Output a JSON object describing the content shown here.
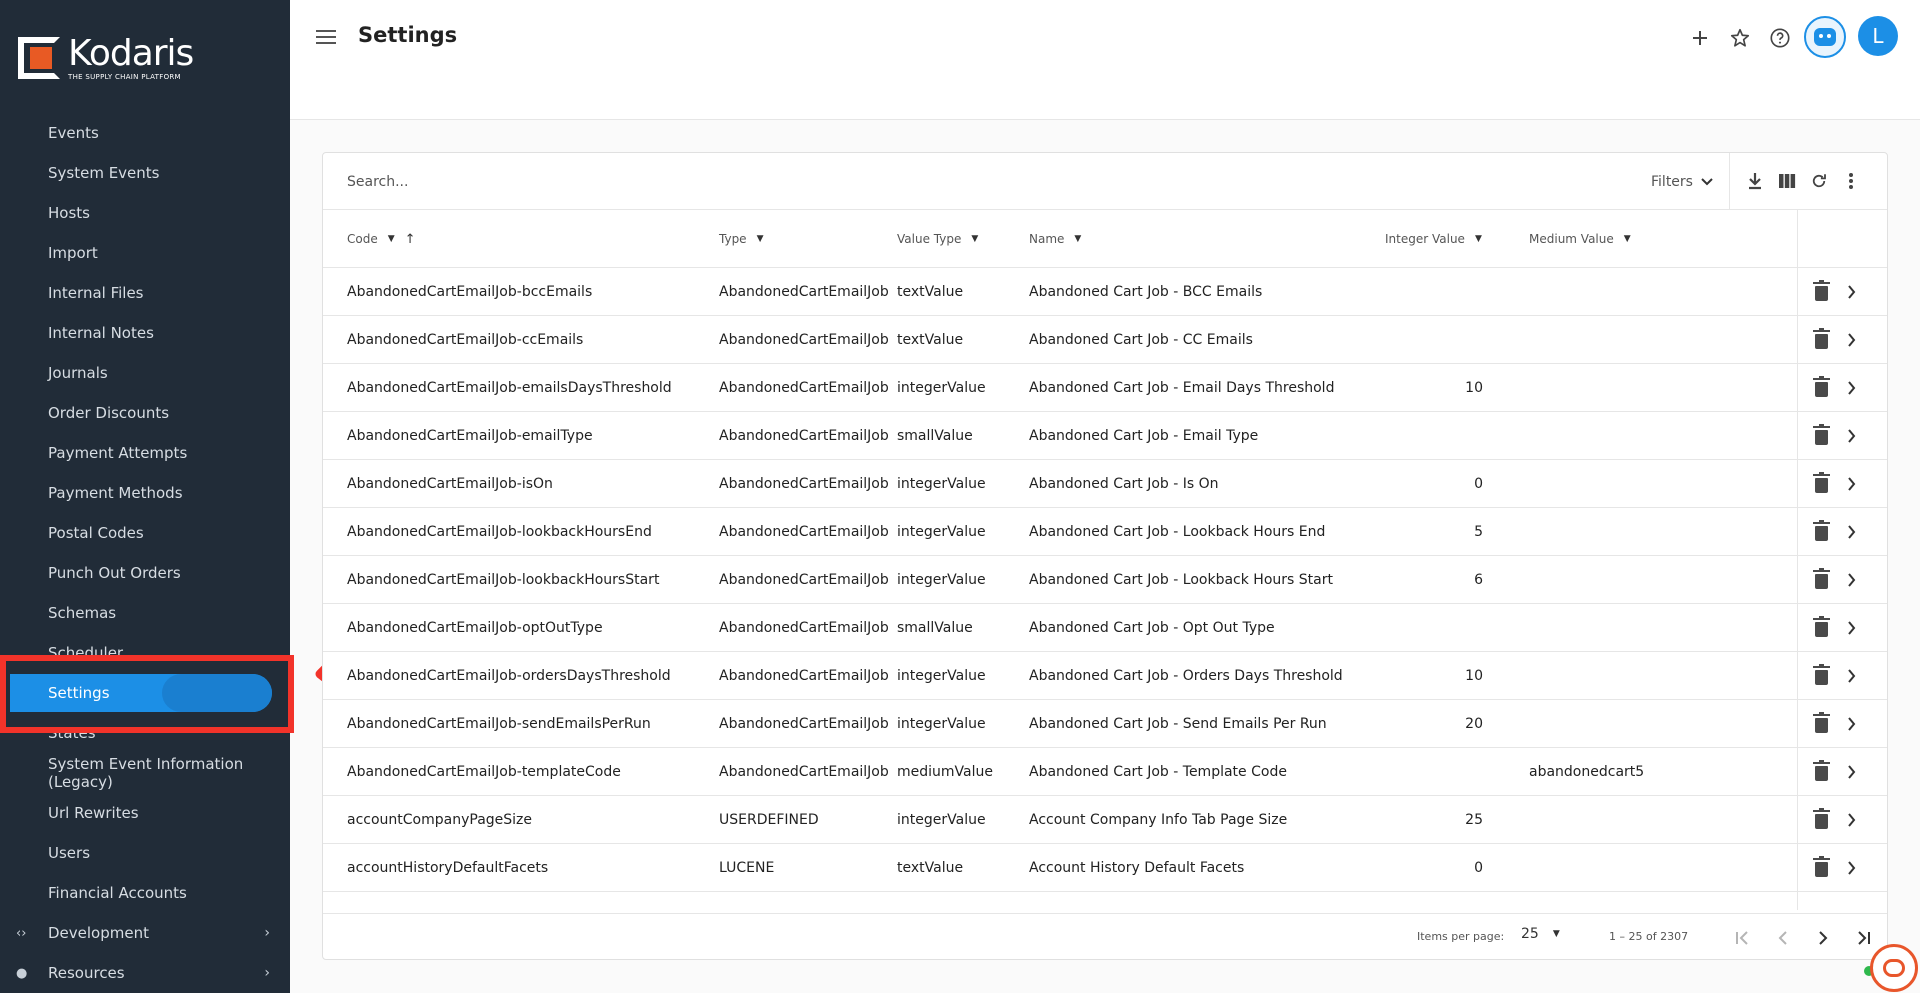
{
  "brand": {
    "name": "Kodaris",
    "tagline": "THE SUPPLY CHAIN PLATFORM",
    "accent": "#1c8fe6",
    "logo_orange": "#e85a24",
    "sidebar_bg": "#212c38"
  },
  "sidebar": {
    "items": [
      {
        "label": "Events"
      },
      {
        "label": "System Events"
      },
      {
        "label": "Hosts"
      },
      {
        "label": "Import"
      },
      {
        "label": "Internal Files"
      },
      {
        "label": "Internal Notes"
      },
      {
        "label": "Journals"
      },
      {
        "label": "Order Discounts"
      },
      {
        "label": "Payment Attempts"
      },
      {
        "label": "Payment Methods"
      },
      {
        "label": "Postal Codes"
      },
      {
        "label": "Punch Out Orders"
      },
      {
        "label": "Schemas"
      },
      {
        "label": "Scheduler"
      },
      {
        "label": "Settings",
        "active": true
      },
      {
        "label": "States"
      },
      {
        "label": "System Event Information (Legacy)"
      },
      {
        "label": "Url Rewrites"
      },
      {
        "label": "Users"
      },
      {
        "label": "Financial Accounts"
      }
    ],
    "sections": [
      {
        "label": "Development",
        "icon": "code-icon"
      },
      {
        "label": "Resources",
        "icon": "help-circle-icon"
      }
    ]
  },
  "header": {
    "title": "Settings",
    "icons": [
      "add-icon",
      "star-icon",
      "help-icon",
      "assistant-bot-icon"
    ],
    "avatar_initial": "L"
  },
  "toolbar": {
    "search_placeholder": "Search...",
    "filters_label": "Filters",
    "icons": [
      "download-icon",
      "columns-icon",
      "refresh-icon",
      "more-vert-icon"
    ]
  },
  "table": {
    "columns": [
      {
        "label": "Code",
        "sorted": "asc"
      },
      {
        "label": "Type"
      },
      {
        "label": "Value Type"
      },
      {
        "label": "Name"
      },
      {
        "label": "Integer Value"
      },
      {
        "label": "Medium Value"
      }
    ],
    "rows": [
      {
        "code": "AbandonedCartEmailJob-bccEmails",
        "type": "AbandonedCartEmailJob",
        "value_type": "textValue",
        "name": "Abandoned Cart Job - BCC Emails",
        "integer_value": "",
        "medium_value": ""
      },
      {
        "code": "AbandonedCartEmailJob-ccEmails",
        "type": "AbandonedCartEmailJob",
        "value_type": "textValue",
        "name": "Abandoned Cart Job - CC Emails",
        "integer_value": "",
        "medium_value": ""
      },
      {
        "code": "AbandonedCartEmailJob-emailsDaysThreshold",
        "type": "AbandonedCartEmailJob",
        "value_type": "integerValue",
        "name": "Abandoned Cart Job - Email Days Threshold",
        "integer_value": "10",
        "medium_value": ""
      },
      {
        "code": "AbandonedCartEmailJob-emailType",
        "type": "AbandonedCartEmailJob",
        "value_type": "smallValue",
        "name": "Abandoned Cart Job - Email Type",
        "integer_value": "",
        "medium_value": ""
      },
      {
        "code": "AbandonedCartEmailJob-isOn",
        "type": "AbandonedCartEmailJob",
        "value_type": "integerValue",
        "name": "Abandoned Cart Job - Is On",
        "integer_value": "0",
        "medium_value": ""
      },
      {
        "code": "AbandonedCartEmailJob-lookbackHoursEnd",
        "type": "AbandonedCartEmailJob",
        "value_type": "integerValue",
        "name": "Abandoned Cart Job - Lookback Hours End",
        "integer_value": "5",
        "medium_value": ""
      },
      {
        "code": "AbandonedCartEmailJob-lookbackHoursStart",
        "type": "AbandonedCartEmailJob",
        "value_type": "integerValue",
        "name": "Abandoned Cart Job - Lookback Hours Start",
        "integer_value": "6",
        "medium_value": ""
      },
      {
        "code": "AbandonedCartEmailJob-optOutType",
        "type": "AbandonedCartEmailJob",
        "value_type": "smallValue",
        "name": "Abandoned Cart Job - Opt Out Type",
        "integer_value": "",
        "medium_value": ""
      },
      {
        "code": "AbandonedCartEmailJob-ordersDaysThreshold",
        "type": "AbandonedCartEmailJob",
        "value_type": "integerValue",
        "name": "Abandoned Cart Job - Orders Days Threshold",
        "integer_value": "10",
        "medium_value": ""
      },
      {
        "code": "AbandonedCartEmailJob-sendEmailsPerRun",
        "type": "AbandonedCartEmailJob",
        "value_type": "integerValue",
        "name": "Abandoned Cart Job - Send Emails Per Run",
        "integer_value": "20",
        "medium_value": ""
      },
      {
        "code": "AbandonedCartEmailJob-templateCode",
        "type": "AbandonedCartEmailJob",
        "value_type": "mediumValue",
        "name": "Abandoned Cart Job - Template Code",
        "integer_value": "",
        "medium_value": "abandonedcart5"
      },
      {
        "code": "accountCompanyPageSize",
        "type": "USERDEFINED",
        "value_type": "integerValue",
        "name": "Account Company Info Tab Page Size",
        "integer_value": "25",
        "medium_value": ""
      },
      {
        "code": "accountHistoryDefaultFacets",
        "type": "LUCENE",
        "value_type": "textValue",
        "name": "Account History Default Facets",
        "integer_value": "0",
        "medium_value": ""
      }
    ]
  },
  "paginator": {
    "items_per_page_label": "Items per page:",
    "items_per_page": "25",
    "range_label": "1 – 25 of 2307"
  },
  "annotation": {
    "color": "#f2332a"
  }
}
